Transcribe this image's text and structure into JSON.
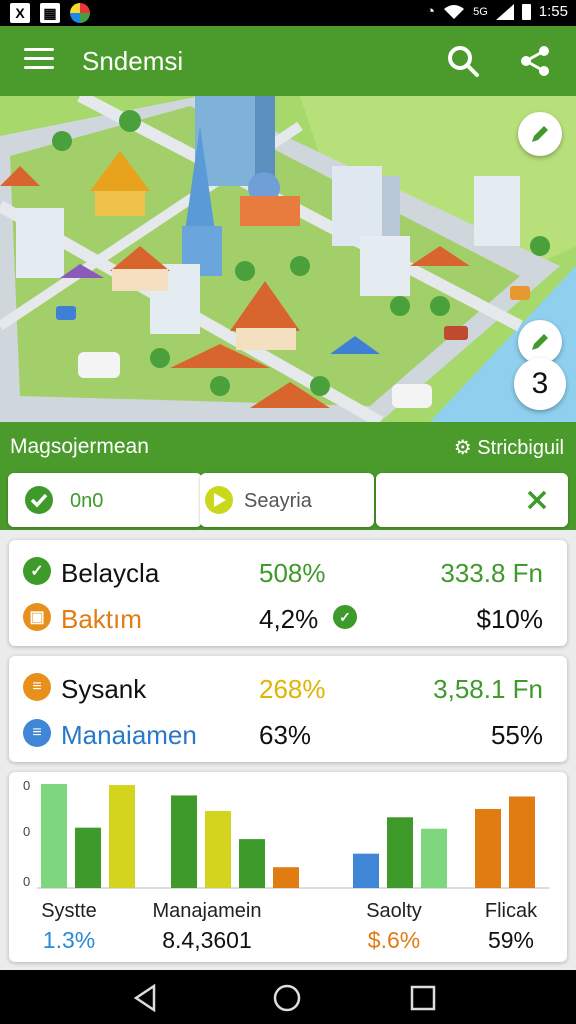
{
  "status": {
    "time": "1:55",
    "signal_label": "5G",
    "left_icons": [
      "app-x-icon",
      "grid-app-icon",
      "chrome-icon"
    ]
  },
  "appbar": {
    "title": "Sndemsi",
    "icons": [
      "menu-icon",
      "search-icon",
      "share-icon"
    ]
  },
  "hero": {
    "badge_count": "3",
    "icons": [
      "edit-pen-icon",
      "edit-pen-icon"
    ]
  },
  "section": {
    "title": "Magsojermean",
    "right_label": "Stricbiguil",
    "right_icon": "gear-icon"
  },
  "tabs": [
    {
      "label": "0n0",
      "icon": "check-circle-icon"
    },
    {
      "label": "Seayria",
      "icon": "arrow-right-icon"
    },
    {
      "label": "",
      "icon": "close-icon"
    }
  ],
  "cards": [
    {
      "rows": [
        {
          "name": "Belaycla",
          "v1": "508%",
          "v2": "333.8 Fn",
          "icon": "check-circle-icon",
          "icon_color": "#3e9a2a",
          "name_color": "#111111",
          "v1_color": "#3e9a2a",
          "v2_color": "#3e9a2a"
        },
        {
          "name": "Baktım",
          "v1": "4,2%",
          "v2": "$10%",
          "icon": "lock-icon",
          "icon_color": "#e8901c",
          "name_color": "#e07c12",
          "v1_color": "#111111",
          "v2_color": "#111111"
        }
      ]
    },
    {
      "rows": [
        {
          "name": "Sysank",
          "v1": "268%",
          "v2": "3,58.1 Fn",
          "icon": "list-icon",
          "icon_color": "#e8901c",
          "name_color": "#111111",
          "v1_color": "#e0b400",
          "v2_color": "#3e9a2a"
        },
        {
          "name": "Manaiamen",
          "v1": "63%",
          "v2": "55%",
          "icon": "list-icon",
          "icon_color": "#3f86d6",
          "name_color": "#2a78c8",
          "v1_color": "#111111",
          "v2_color": "#111111"
        }
      ]
    }
  ],
  "chart_data": {
    "type": "bar",
    "y_tick_labels": [
      "0",
      "0",
      "0"
    ],
    "groups": [
      {
        "label": "Systte",
        "value_label": "1.3%",
        "value_color": "#2a8ad4",
        "values": [
          100,
          58,
          99
        ],
        "colors": [
          "#7ed67e",
          "#3e9a2a",
          "#d4d41e"
        ]
      },
      {
        "label": "Manajamein",
        "value_label": "8.4,3601",
        "value_color": "#111111",
        "values": [
          89,
          74,
          47,
          20
        ],
        "colors": [
          "#3e9a2a",
          "#d4d41e",
          "#3e9a2a",
          "#e07c12"
        ]
      },
      {
        "label": "Saolty",
        "value_label": "$.6%",
        "value_color": "#e07c12",
        "values": [
          33,
          68,
          57
        ],
        "colors": [
          "#3f86d6",
          "#3e9a2a",
          "#7ed67e"
        ]
      },
      {
        "label": "Flicak",
        "value_label": "59%",
        "value_color": "#111111",
        "values": [
          76,
          88
        ],
        "colors": [
          "#e07c12",
          "#e07c12"
        ]
      }
    ]
  }
}
